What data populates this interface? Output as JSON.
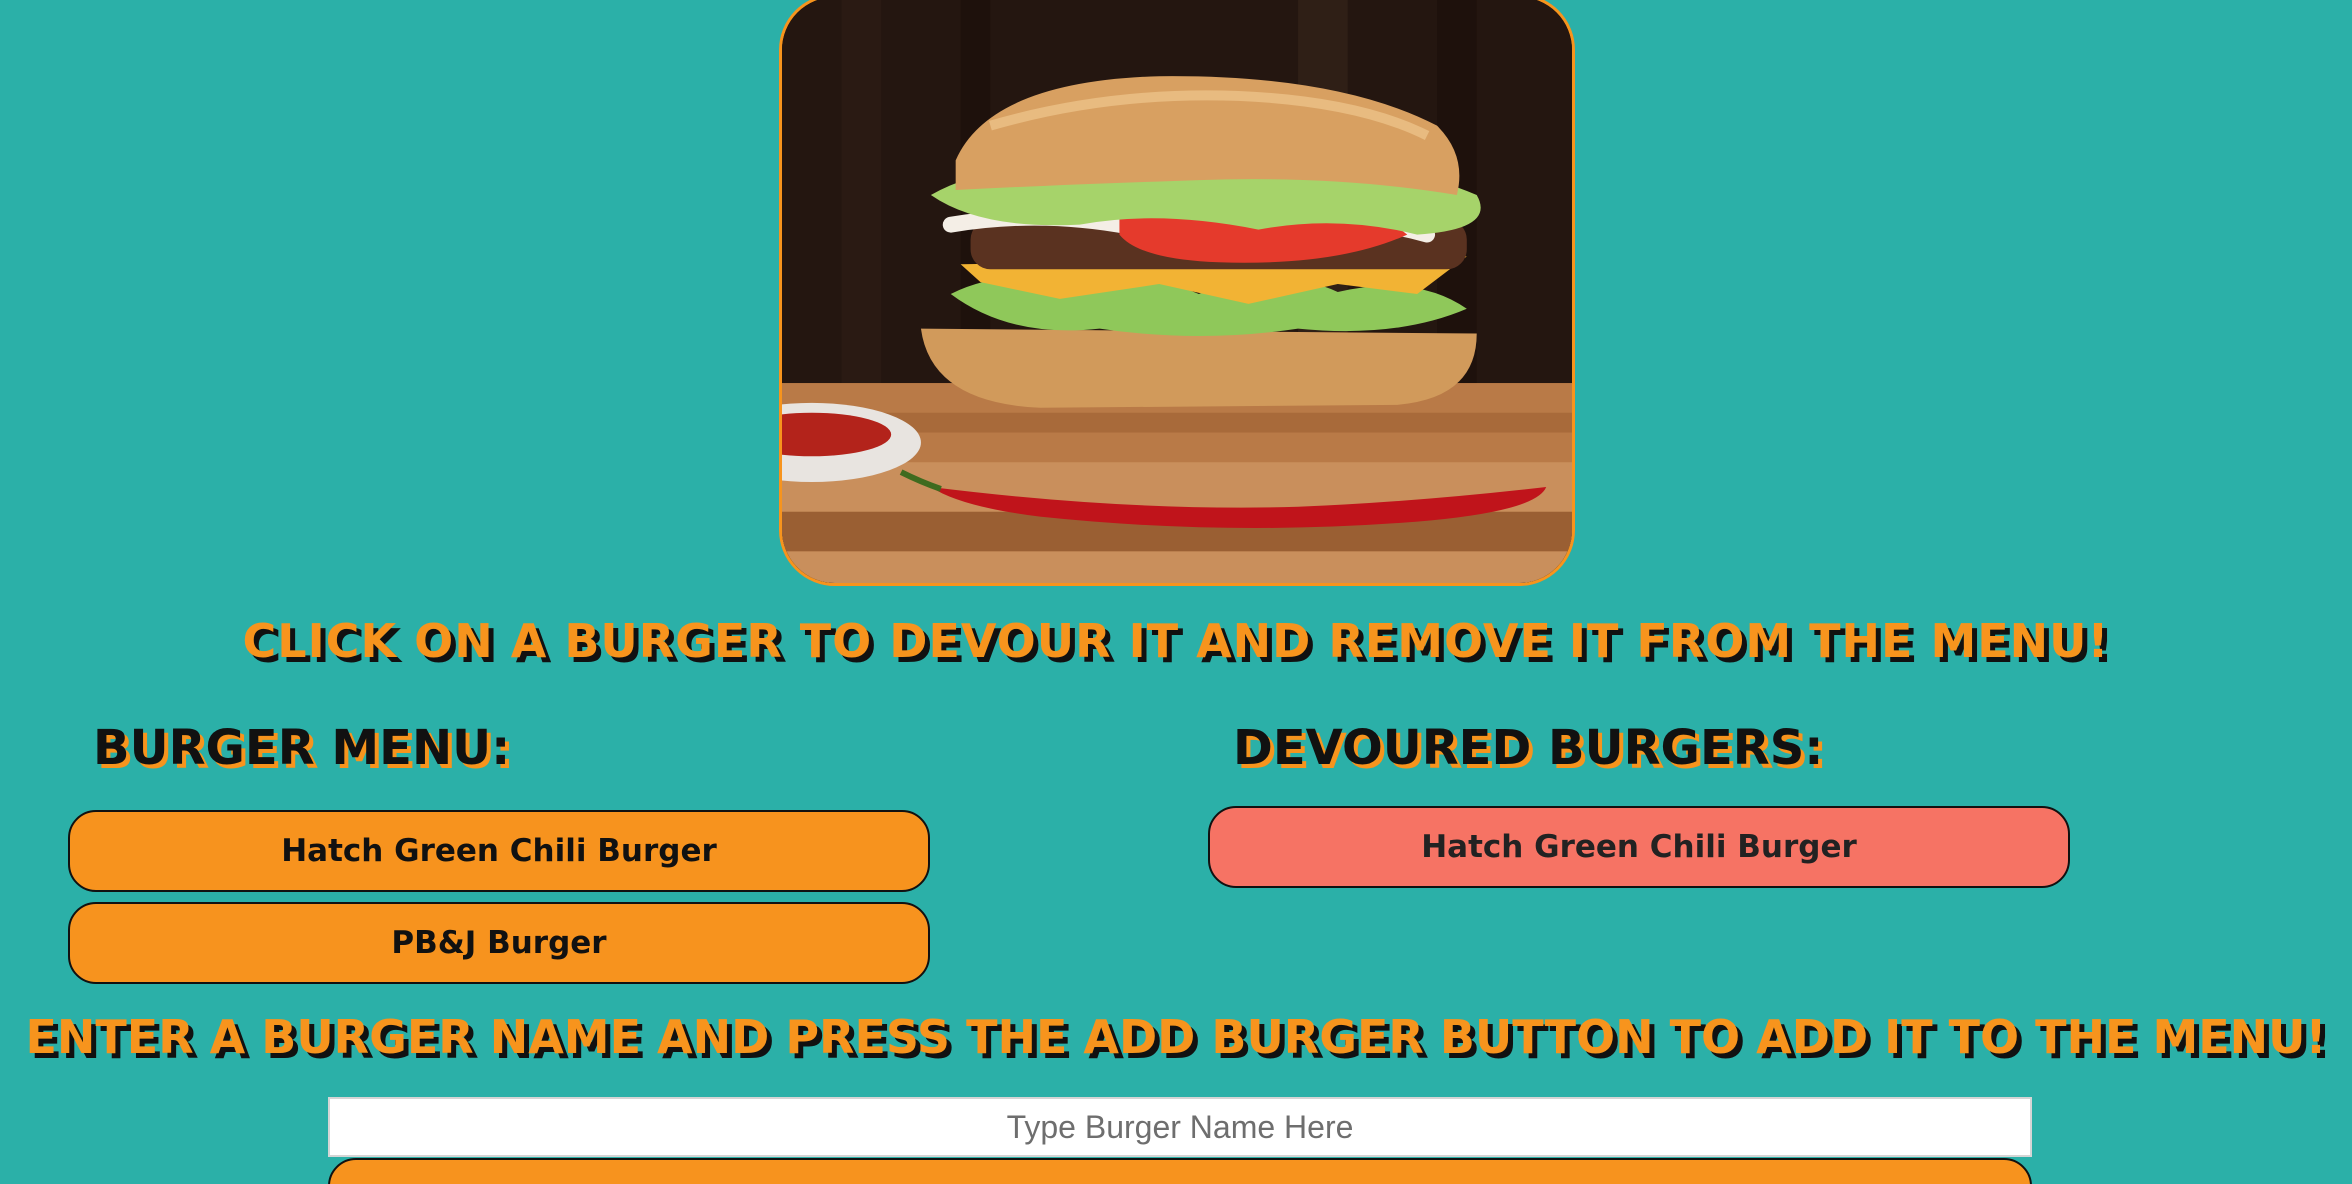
{
  "hero": {
    "image": "burger-photo"
  },
  "instructions": {
    "devour": "Click on a burger to devour it and remove it from the menu!",
    "add": "Enter a burger name and press the add burger button to add it to the menu!"
  },
  "menu": {
    "heading": "Burger Menu:",
    "items": [
      {
        "label": "Hatch Green Chili Burger"
      },
      {
        "label": "PB&J Burger"
      }
    ]
  },
  "devoured": {
    "heading": "Devoured Burgers:",
    "items": [
      {
        "label": "Hatch Green Chili Burger"
      }
    ]
  },
  "form": {
    "placeholder": "Type Burger Name Here",
    "value": ""
  },
  "colors": {
    "background": "#2bb0a8",
    "accent_orange": "#f7931e",
    "devoured_salmon": "#f67364",
    "text_dark": "#111111"
  }
}
